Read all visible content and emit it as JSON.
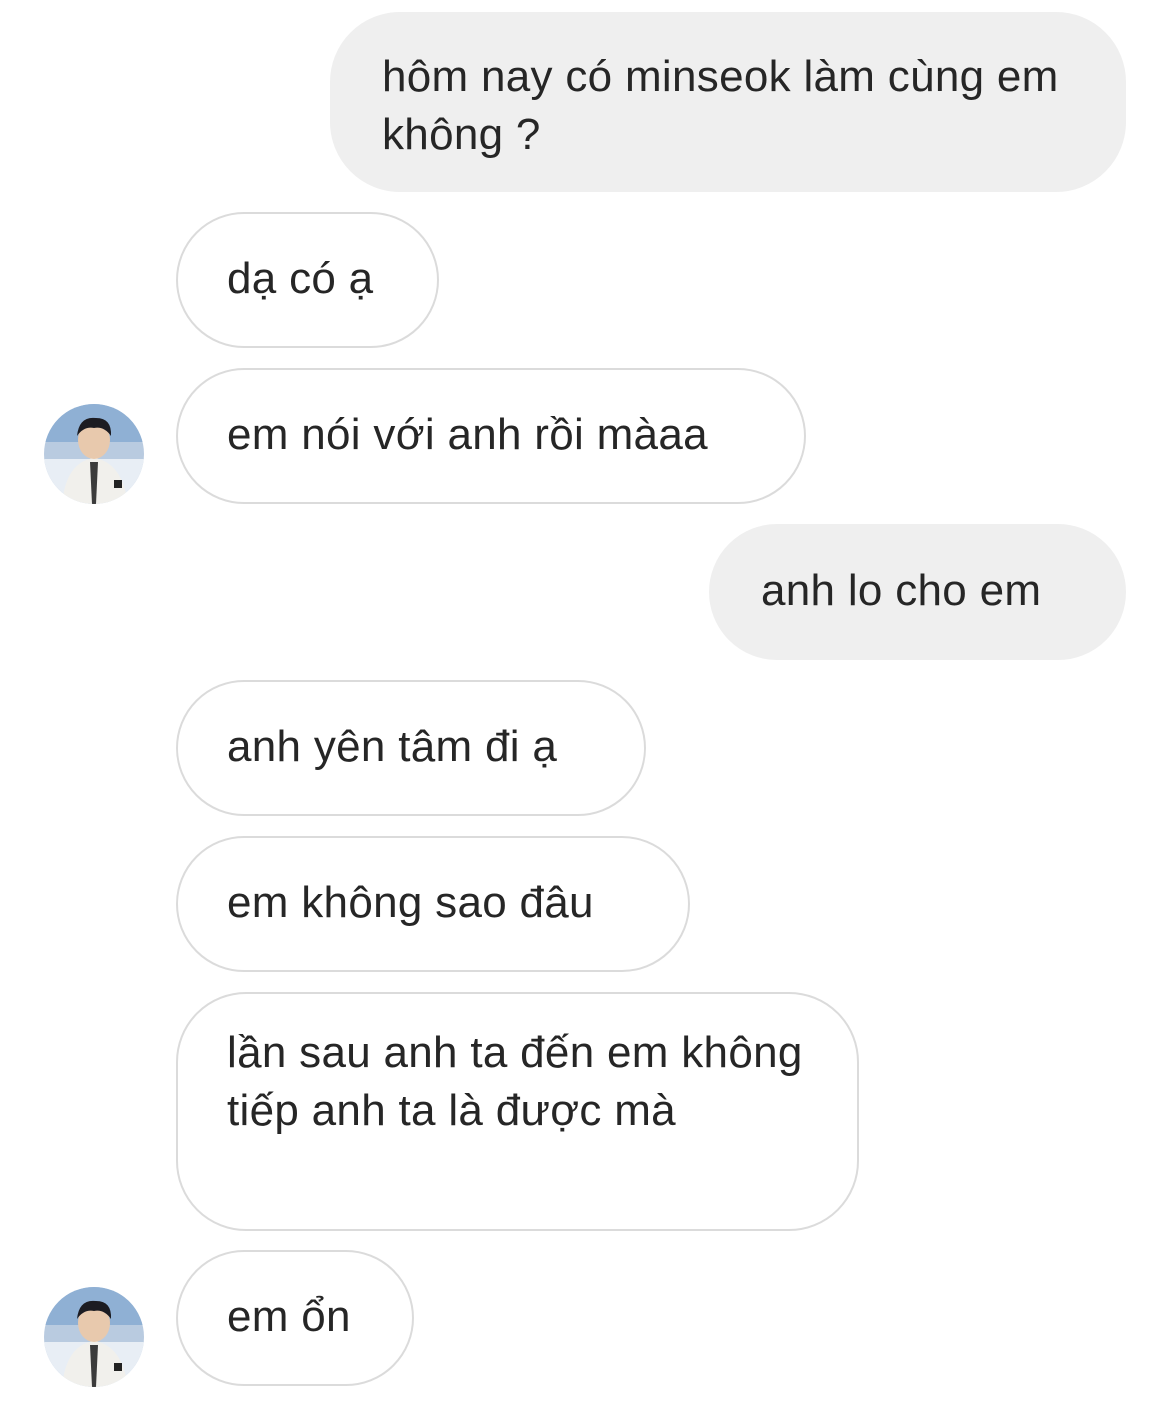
{
  "conversation": {
    "messages": [
      {
        "direction": "sent",
        "text": "hôm nay có minseok làm cùng em không ?"
      },
      {
        "direction": "received",
        "text": "dạ có ạ"
      },
      {
        "direction": "received",
        "text": "em nói với anh rồi màaa"
      },
      {
        "direction": "sent",
        "text": "anh lo cho em"
      },
      {
        "direction": "received",
        "text": "anh yên tâm đi ạ"
      },
      {
        "direction": "received",
        "text": "em không sao đâu"
      },
      {
        "direction": "received",
        "text": "lần sau anh ta đến em không tiếp anh ta là được mà"
      },
      {
        "direction": "received",
        "text": "em ổn"
      }
    ]
  },
  "colors": {
    "sent_bubble_bg": "#efefef",
    "received_bubble_border": "#dbdbdb",
    "text": "#262626"
  },
  "icons": {
    "avatar": "user-avatar-photo"
  }
}
